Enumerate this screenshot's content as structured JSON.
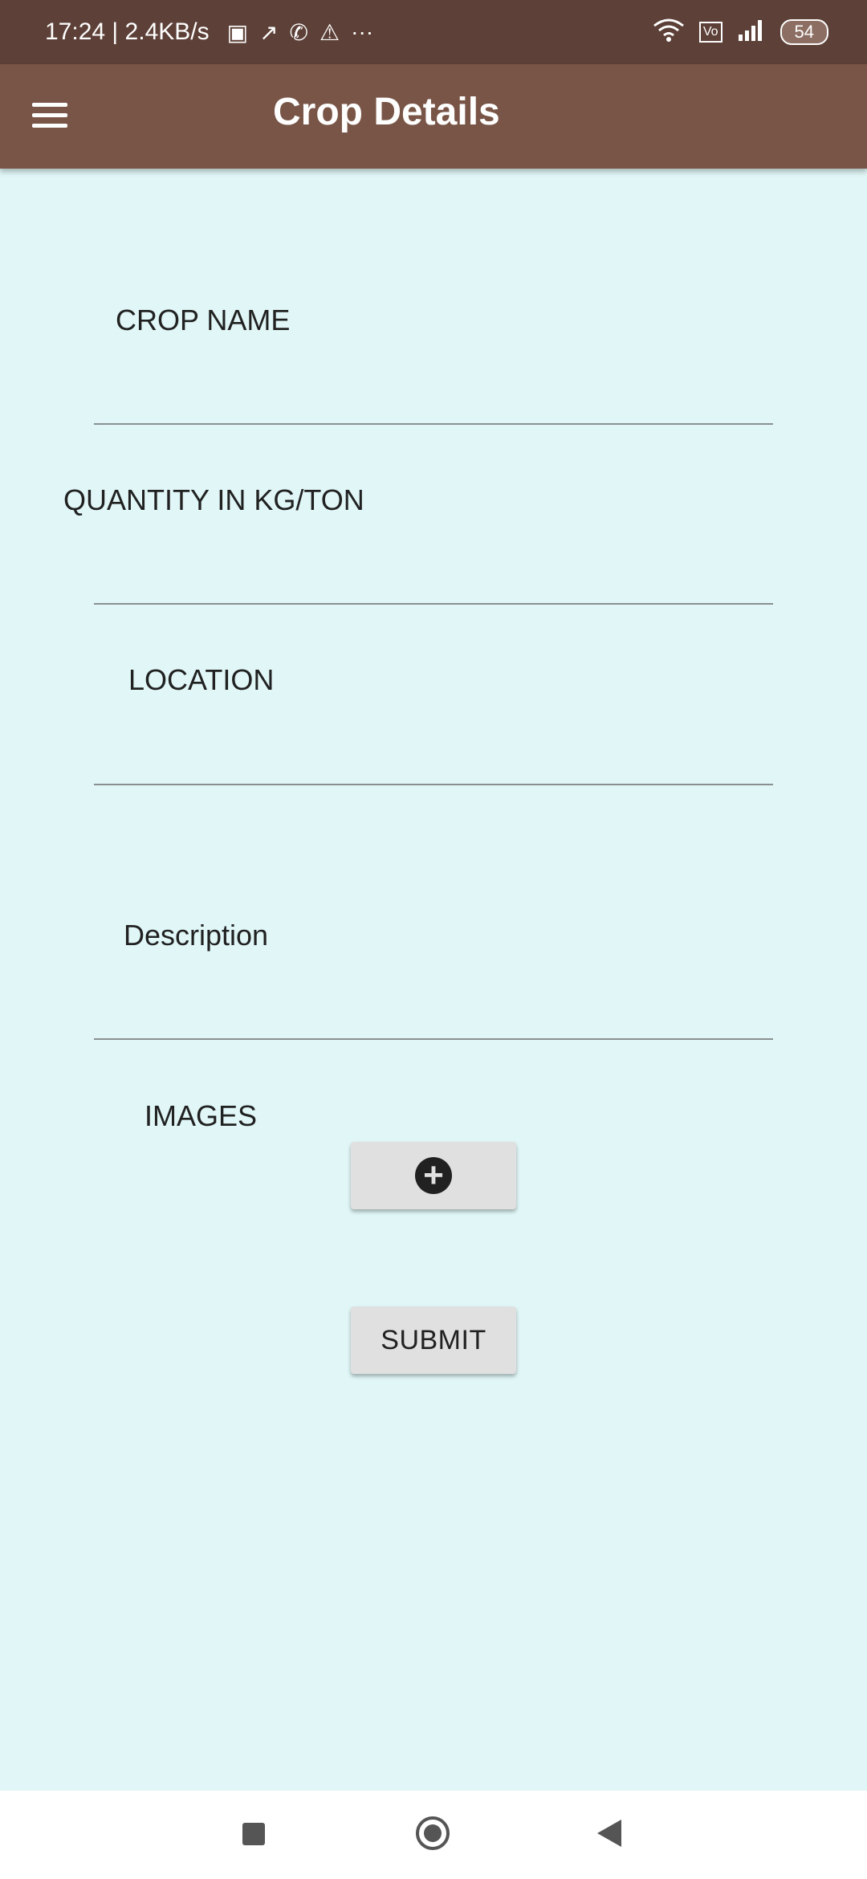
{
  "status_bar": {
    "time": "17:24",
    "speed": "2.4KB/s",
    "icons_left": [
      "video-call-icon",
      "missed-call-icon",
      "phone-icon",
      "warning-icon",
      "more-dots-icon"
    ],
    "icons_right": [
      "wifi-icon",
      "volte-icon",
      "signal-icon"
    ],
    "battery": "54"
  },
  "app_bar": {
    "title": "Crop Details",
    "menu_icon": "hamburger-menu-icon"
  },
  "form": {
    "crop_name_label": "CROP NAME",
    "crop_name_value": "",
    "quantity_label": "QUANTITY IN KG/TON",
    "quantity_value": "",
    "location_label": "LOCATION",
    "location_value": "",
    "description_label": "Description",
    "description_value": "",
    "images_label": "IMAGES",
    "add_image_icon": "plus-circle-icon",
    "submit_label": "SUBMIT"
  },
  "nav_bar": {
    "icons": [
      "recents-icon",
      "home-icon",
      "back-icon"
    ]
  },
  "colors": {
    "status_bar": "#5d4037",
    "app_bar": "#795548",
    "background": "#e0f6f7",
    "button": "#e0e0e0"
  }
}
